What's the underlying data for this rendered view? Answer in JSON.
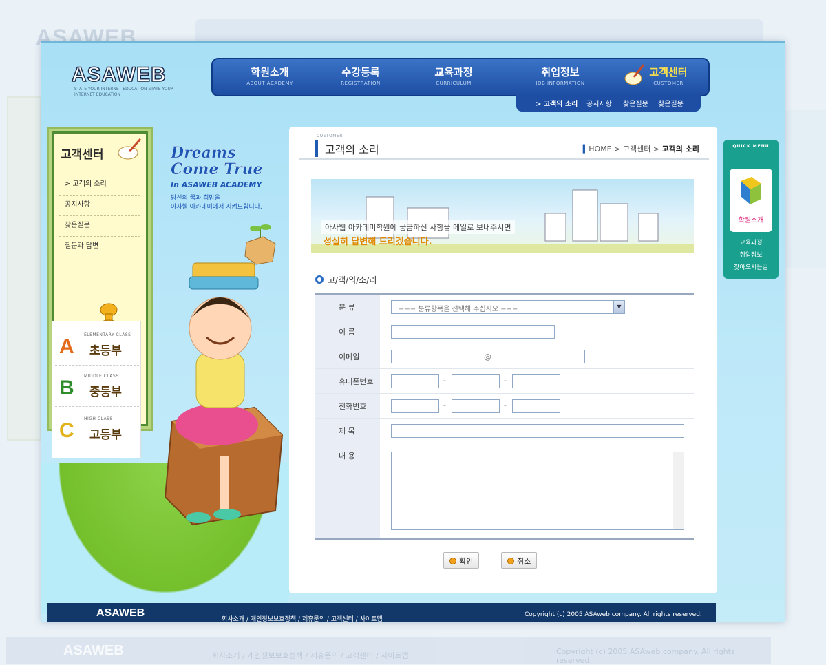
{
  "logo": "ASAWEB",
  "logo_sub": "STATE YOUR INTERNET EDUCATION STATE YOUR INTERNET EDUCATION",
  "nav": [
    {
      "ko": "학원소개",
      "en": "ABOUT ACADEMY"
    },
    {
      "ko": "수강등록",
      "en": "REGISTRATION"
    },
    {
      "ko": "교육과정",
      "en": "CURRICULUM"
    },
    {
      "ko": "취업정보",
      "en": "JOB INFORMATION"
    },
    {
      "ko": "고객센터",
      "en": "CUSTOMER"
    }
  ],
  "subnav": [
    "> 고객의 소리",
    "공지사항",
    "찾은질문",
    "찾은질문"
  ],
  "sidebar": {
    "title": "고객센터",
    "items": [
      "> 고객의 소리",
      "공지사항",
      "찾은질문",
      "질문과 답변"
    ]
  },
  "classes": [
    {
      "letter": "A",
      "en": "ELEMENTARY CLASS",
      "ko": "초등부"
    },
    {
      "letter": "B",
      "en": "MIDDLE CLASS",
      "ko": "중등부"
    },
    {
      "letter": "C",
      "en": "HIGH CLASS",
      "ko": "고등부"
    }
  ],
  "hero": {
    "line1": "Dreams",
    "line2": "Come True",
    "line3": "In ASAWEB ACADEMY",
    "sub1": "당신의 꿈과 희망을",
    "sub2": "아사웹 아카데미에서 지켜드립니다."
  },
  "page": {
    "kicker": "CUSTOMER",
    "title": "고객의 소리",
    "breadcrumb": {
      "home": "HOME",
      "mid": "고객센터",
      "current": "고객의 소리"
    }
  },
  "banner": {
    "line1": "아사웹 아카데미학원에 궁금하신 사항을 메일로 보내주시면",
    "line2": "성실히 답변해 드리겠습니다."
  },
  "form": {
    "section": "고/객/의/소/리",
    "labels": {
      "category": "분 류",
      "name": "이 름",
      "email": "이메일",
      "mobile": "휴대폰번호",
      "phone": "전화번호",
      "subject": "제 목",
      "content": "내 용"
    },
    "category_value": "=== 분류항목을 선택해 주십시오 ===",
    "email_at": "@",
    "dash": "-"
  },
  "buttons": {
    "confirm": "확인",
    "cancel": "취소"
  },
  "quick_menu": {
    "title": "QUICK MENU",
    "card_label": "학원소개",
    "links": [
      "교육과정",
      "취업정보",
      "찾아오시는길"
    ]
  },
  "footer": {
    "logo": "ASAWEB",
    "links": "회사소개 / 개인정보보호정책 / 제휴문의 / 고객센터 / 사이트맵",
    "copyright": "Copyright (c) 2005 ASAweb company. All rights reserved."
  },
  "colors": {
    "nav": "#1d4ea3",
    "accent": "#ffe24a",
    "footer": "#12386a",
    "quick": "#1aa08f"
  }
}
